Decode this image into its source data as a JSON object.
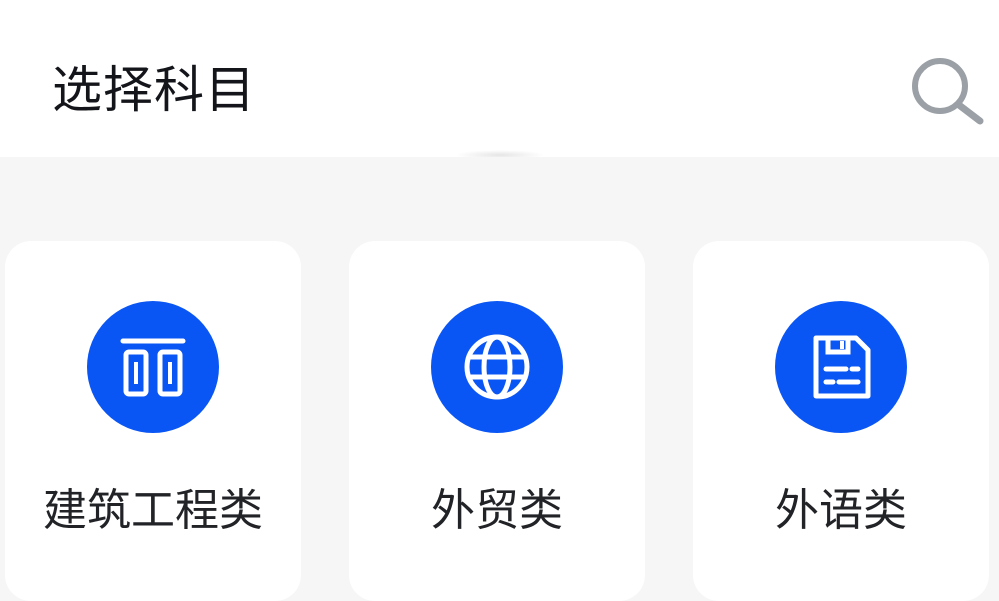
{
  "header": {
    "title": "选择科目",
    "search_icon": "search-icon"
  },
  "categories": [
    {
      "label": "建筑工程类",
      "icon": "building-columns-icon"
    },
    {
      "label": "外贸类",
      "icon": "globe-icon"
    },
    {
      "label": "外语类",
      "icon": "floppy-document-icon"
    }
  ],
  "colors": {
    "accent": "#0a56f5",
    "background": "#f6f6f7",
    "card": "#ffffff",
    "title_text": "#14151a",
    "search_icon": "#9aa0a6"
  }
}
